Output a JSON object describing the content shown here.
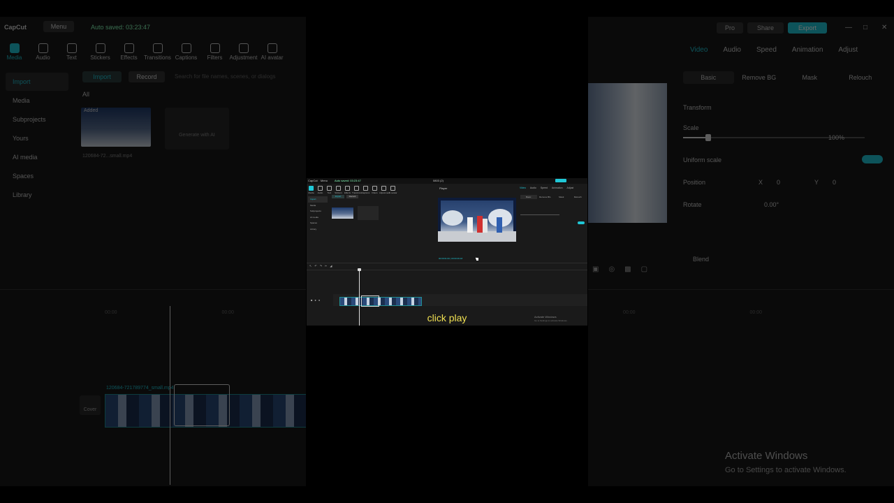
{
  "caption": "click play",
  "background_left": {
    "app_title": "CapCut",
    "menu_label": "Menu",
    "autosave": "Auto saved: 03:23:47",
    "tools": [
      "Media",
      "Audio",
      "Text",
      "Stickers",
      "Effects",
      "Transitions",
      "Captions",
      "Filters",
      "Adjustment",
      "AI avatar"
    ],
    "sidebar": [
      "Import",
      "Media",
      "Subprojects",
      "Yours",
      "AI media",
      "Spaces",
      "Library"
    ],
    "import_label": "Import",
    "record_label": "Record",
    "search_placeholder": "Search for file names, scenes, or dialogs",
    "all_label": "All",
    "added_label": "Added",
    "thumb_name": "120684-72...small.mp4",
    "generate_label": "Generate with AI",
    "ruler_marks": [
      "00:00",
      "00:00"
    ],
    "clip_label": "120684-721789774_small.mp4",
    "cover_label": "Cover"
  },
  "background_right": {
    "pro_label": "Pro",
    "share_label": "Share",
    "export_label": "Export",
    "tabs": [
      "Video",
      "Audio",
      "Speed",
      "Animation",
      "Adjust"
    ],
    "subtabs": [
      "Basic",
      "Remove BG",
      "Mask",
      "Relouch"
    ],
    "transform_label": "Transform",
    "scale_label": "Scale",
    "scale_value": "100%",
    "uniform_scale_label": "Uniform scale",
    "position_label": "Position",
    "pos_x_label": "X",
    "pos_x": "0",
    "pos_y_label": "Y",
    "pos_y": "0",
    "rotate_label": "Rotate",
    "rotate_value": "0.00°",
    "blend_label": "Blend",
    "ruler_marks": [
      "00:00",
      "00:00"
    ],
    "activate_title": "Activate Windows",
    "activate_sub": "Go to Settings to activate Windows."
  },
  "mini": {
    "app_title": "CapCut",
    "menu_label": "Menu",
    "autosave": "Auto saved: 03:23:47",
    "window_title": "0803 (2)",
    "player_label": "Player",
    "timecode": "00:00:01:00 | 00:00:09:18",
    "tools": [
      "Media",
      "Audio",
      "Text",
      "Stickers",
      "Effects",
      "Transitions",
      "Captions",
      "Filters",
      "Adjustment",
      "AI avatar"
    ],
    "sidebar": [
      "Import",
      "Media",
      "Subprojects",
      "AI media",
      "Spaces",
      "Library"
    ],
    "import_label": "Import",
    "record_label": "Record",
    "right_tabs": [
      "Video",
      "Audio",
      "Speed",
      "Animation",
      "Adjust"
    ],
    "right_subtabs": [
      "Basic",
      "Remove BG",
      "Mask",
      "Relouch"
    ],
    "activate_title": "Activate Windows",
    "activate_sub": "Go to Settings to activate Windows."
  }
}
